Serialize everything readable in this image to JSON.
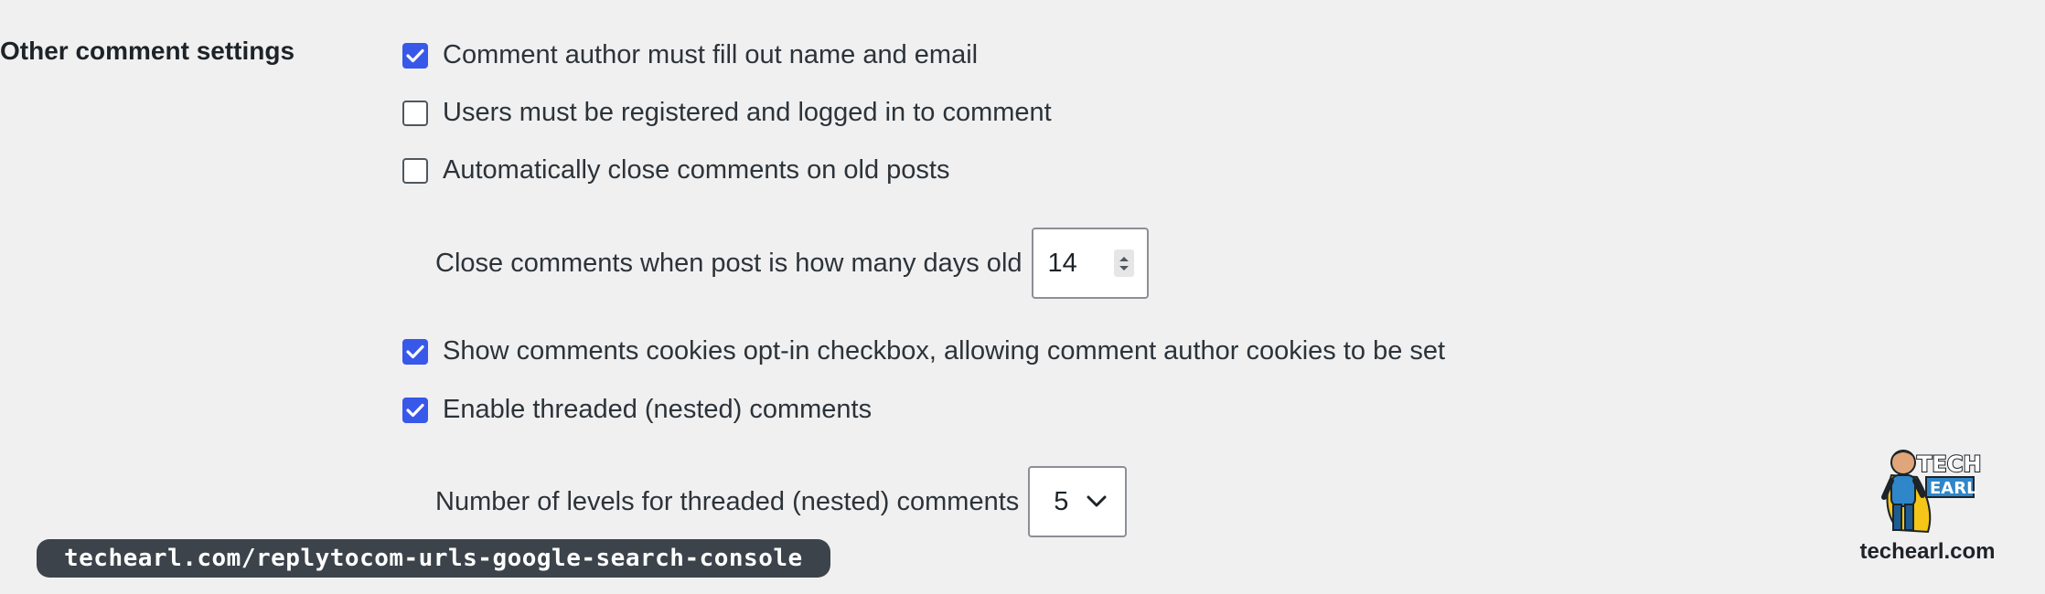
{
  "section": {
    "label": "Other comment settings"
  },
  "options": {
    "require_name_email": {
      "label": "Comment author must fill out name and email",
      "checked": true
    },
    "registration_required": {
      "label": "Users must be registered and logged in to comment",
      "checked": false
    },
    "close_old_posts": {
      "label": "Automatically close comments on old posts",
      "checked": false
    },
    "close_days": {
      "label": "Close comments when post is how many days old",
      "value": "14"
    },
    "cookies_opt_in": {
      "label": "Show comments cookies opt-in checkbox, allowing comment author cookies to be set",
      "checked": true
    },
    "threaded_comments": {
      "label": "Enable threaded (nested) comments",
      "checked": true
    },
    "thread_depth": {
      "label": "Number of levels for threaded (nested) comments",
      "value": "5"
    }
  },
  "overlay": {
    "url": "techearl.com/replytocom-urls-google-search-console",
    "logo_text": "TECH EARL",
    "site": "techearl.com"
  },
  "colors": {
    "accent": "#3858e9",
    "background": "#f0f0f1",
    "pill": "#3c434a"
  }
}
